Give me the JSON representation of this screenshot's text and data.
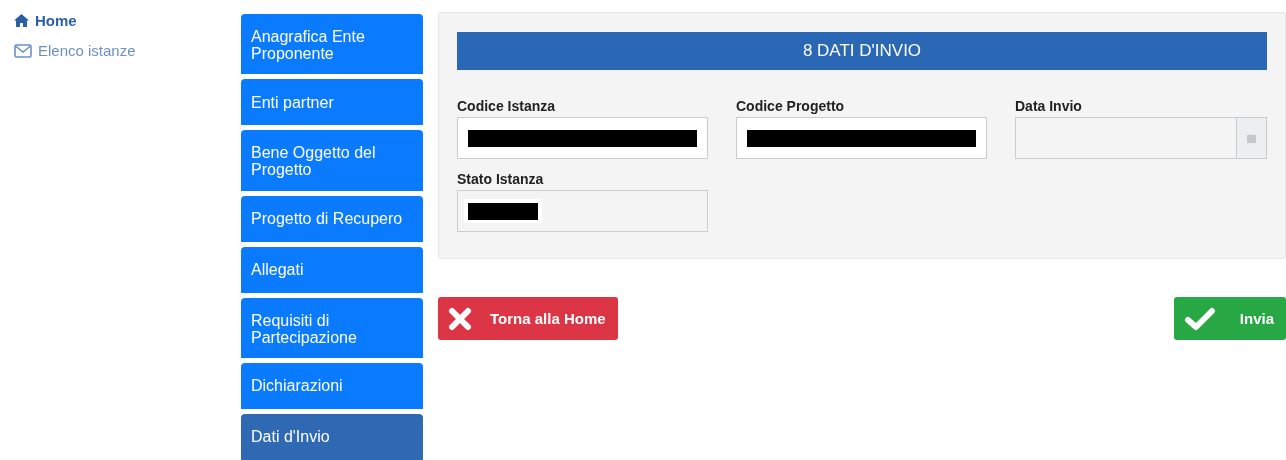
{
  "sidebar": {
    "items": [
      {
        "label": "Home",
        "selected": true
      },
      {
        "label": "Elenco istanze",
        "selected": false
      }
    ]
  },
  "steps": [
    {
      "label": "Anagrafica Ente Proponente",
      "selected": false
    },
    {
      "label": "Enti partner",
      "selected": false
    },
    {
      "label": "Bene Oggetto del Progetto",
      "selected": false
    },
    {
      "label": "Progetto di Recupero",
      "selected": false
    },
    {
      "label": "Allegati",
      "selected": false
    },
    {
      "label": "Requisiti di Partecipazione",
      "selected": false
    },
    {
      "label": "Dichiarazioni",
      "selected": false
    },
    {
      "label": "Dati d'Invio",
      "selected": true
    }
  ],
  "panel": {
    "title": "8 DATI D'INVIO",
    "fields": [
      {
        "label": "Codice Istanza",
        "kind": "redacted"
      },
      {
        "label": "Codice Progetto",
        "kind": "redacted"
      },
      {
        "label": "Data Invio",
        "kind": "date"
      },
      {
        "label": "Stato Istanza",
        "kind": "readonly-redacted"
      }
    ]
  },
  "buttons": [
    {
      "label": "Torna alla Home",
      "kind": "cancel"
    },
    {
      "label": "Invia",
      "kind": "confirm"
    }
  ]
}
